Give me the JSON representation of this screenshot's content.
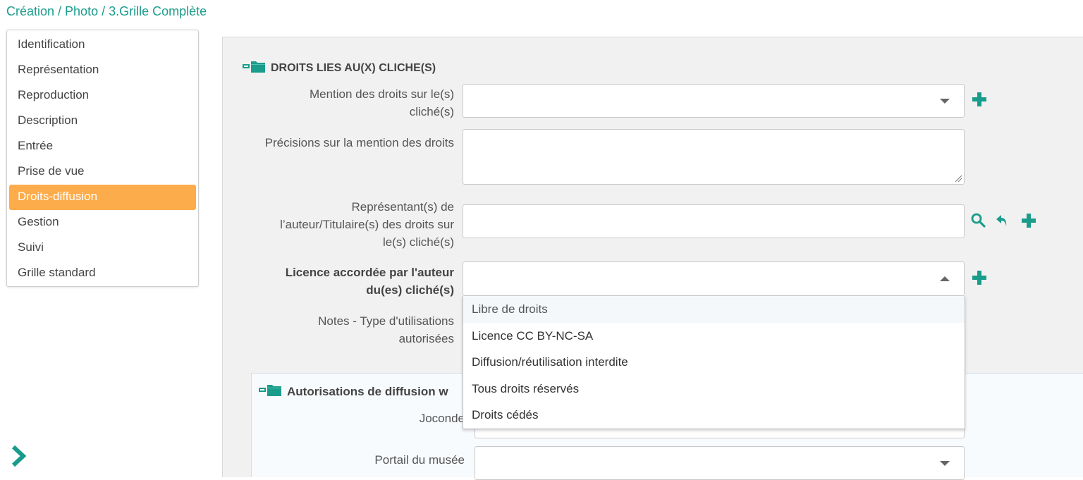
{
  "breadcrumb": "Création / Photo / 3.Grille Complète",
  "sidebar": {
    "items": [
      {
        "label": "Identification"
      },
      {
        "label": "Représentation"
      },
      {
        "label": "Reproduction"
      },
      {
        "label": "Description"
      },
      {
        "label": "Entrée"
      },
      {
        "label": "Prise de vue"
      },
      {
        "label": "Droits-diffusion",
        "active": true
      },
      {
        "label": "Gestion"
      },
      {
        "label": "Suivi"
      },
      {
        "label": "Grille standard"
      }
    ]
  },
  "section": {
    "title": "DROITS LIES AU(X) CLICHE(S)",
    "fields": {
      "mention": {
        "label_line1": "Mention des droits sur le(s)",
        "label_line2": "cliché(s)",
        "value": ""
      },
      "precisions": {
        "label": "Précisions sur la mention des droits",
        "value": ""
      },
      "representant": {
        "label_line1": "Représentant(s) de",
        "label_line2": "l’auteur/Titulaire(s) des droits sur",
        "label_line3": "le(s) cliché(s)",
        "value": ""
      },
      "licence": {
        "label_line1": "Licence accordée par l'auteur",
        "label_line2": "du(es) cliché(s)",
        "value": ""
      },
      "notes": {
        "label_line1": "Notes - Type d'utilisations",
        "label_line2": "autorisées"
      }
    }
  },
  "licence_options": [
    "Libre de droits",
    "Licence CC BY-NC-SA",
    "Diffusion/réutilisation interdite",
    "Tous droits réservés",
    "Droits cédés"
  ],
  "subsection": {
    "title": "Autorisations de diffusion w",
    "fields": {
      "joconde": {
        "label": "Joconde"
      },
      "portail": {
        "label": "Portail du musée",
        "value": ""
      }
    }
  },
  "colors": {
    "accent": "#1a9c8c",
    "active_bg": "#fdac4b",
    "panel_bg": "#f1f1f1"
  }
}
